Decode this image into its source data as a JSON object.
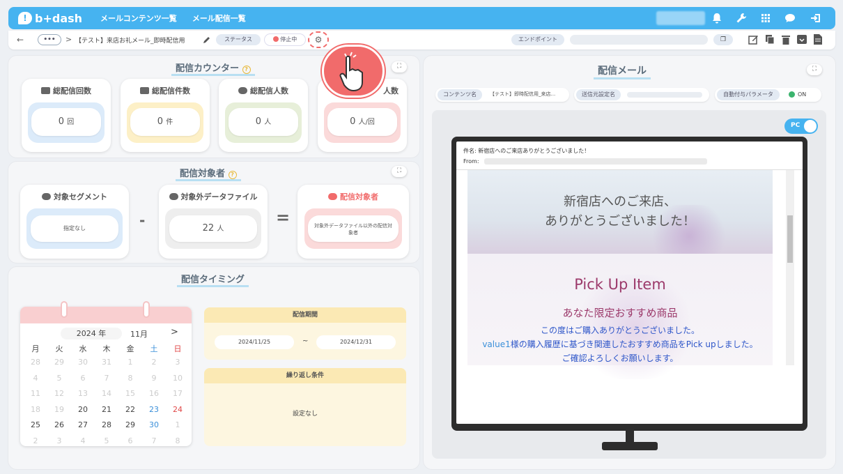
{
  "app": {
    "logo_text": "b+dash",
    "nav": [
      "メールコンテンツ一覧",
      "メール配信一覧"
    ]
  },
  "subbar": {
    "back": "←",
    "more": "•••",
    "sep": ">",
    "title": "【テスト】来店お礼メール_即時配信用",
    "status_label": "ステータス",
    "status_value": "停止中",
    "endpoint_label": "エンドポイント"
  },
  "counter": {
    "title": "配信カウンター",
    "cards": [
      {
        "label": "総配信回数",
        "value": "0",
        "unit": "回",
        "color": "#dcebfa"
      },
      {
        "label": "総配信件数",
        "value": "0",
        "unit": "件",
        "color": "#fdf0c7"
      },
      {
        "label": "総配信人数",
        "value": "0",
        "unit": "人",
        "color": "#e7efd9"
      },
      {
        "label": "人数",
        "value": "0",
        "unit": "人/回",
        "color": "#fbdada"
      }
    ]
  },
  "targets": {
    "title": "配信対象者",
    "segment_label": "対象セグメント",
    "segment_value": "指定なし",
    "minus": "-",
    "excluded_label": "対象外データファイル",
    "excluded_value": "22",
    "excluded_unit": "人",
    "equals": "=",
    "result_label": "配信対象者",
    "result_value": "対象外データファイル以外の配信対象者"
  },
  "timing": {
    "title": "配信タイミング",
    "calendar": {
      "year": "2024 年",
      "month": "11月",
      "next": ">",
      "dow": [
        "月",
        "火",
        "水",
        "木",
        "金",
        "土",
        "日"
      ],
      "weeks": [
        [
          "28",
          "29",
          "30",
          "31",
          "1",
          "2",
          "3"
        ],
        [
          "4",
          "5",
          "6",
          "7",
          "8",
          "9",
          "10"
        ],
        [
          "11",
          "12",
          "13",
          "14",
          "15",
          "16",
          "17"
        ],
        [
          "18",
          "19",
          "20",
          "21",
          "22",
          "23",
          "24"
        ],
        [
          "25",
          "26",
          "27",
          "28",
          "29",
          "30",
          "1"
        ],
        [
          "2",
          "3",
          "4",
          "5",
          "6",
          "7",
          "8"
        ]
      ]
    },
    "period_label": "配信期間",
    "period_start": "2024/11/25",
    "period_sep": "~",
    "period_end": "2024/12/31",
    "repeat_label": "繰り返し条件",
    "repeat_value": "設定なし"
  },
  "mail": {
    "title": "配信メール",
    "content_label": "コンテンツ名",
    "content_value": "【テスト】即時配信用_来店...",
    "sender_label": "送信元設定名",
    "param_label": "自動付与パラメータ",
    "param_value": "ON",
    "pc_toggle": "PC",
    "subject": "件名: 新宿店へのご来店ありがとうございました！",
    "from": "From:",
    "hero_line1": "新宿店へのご来店、",
    "hero_line2": "ありがとうございました！",
    "pickup": "Pick Up Item",
    "pickup_sub": "あなた限定おすすめ商品",
    "body1": "この度はご購入ありがとうございました。",
    "body2_var": "value1",
    "body2": "様の購入履歴に基づき関連したおすすめ商品をPick upしました。",
    "body3": "ご確認よろしくお願いします。"
  },
  "colors": {
    "accent": "#46b3f0",
    "red": "#f16b6b",
    "sat": "#3a8fd9",
    "sun": "#e04848"
  }
}
